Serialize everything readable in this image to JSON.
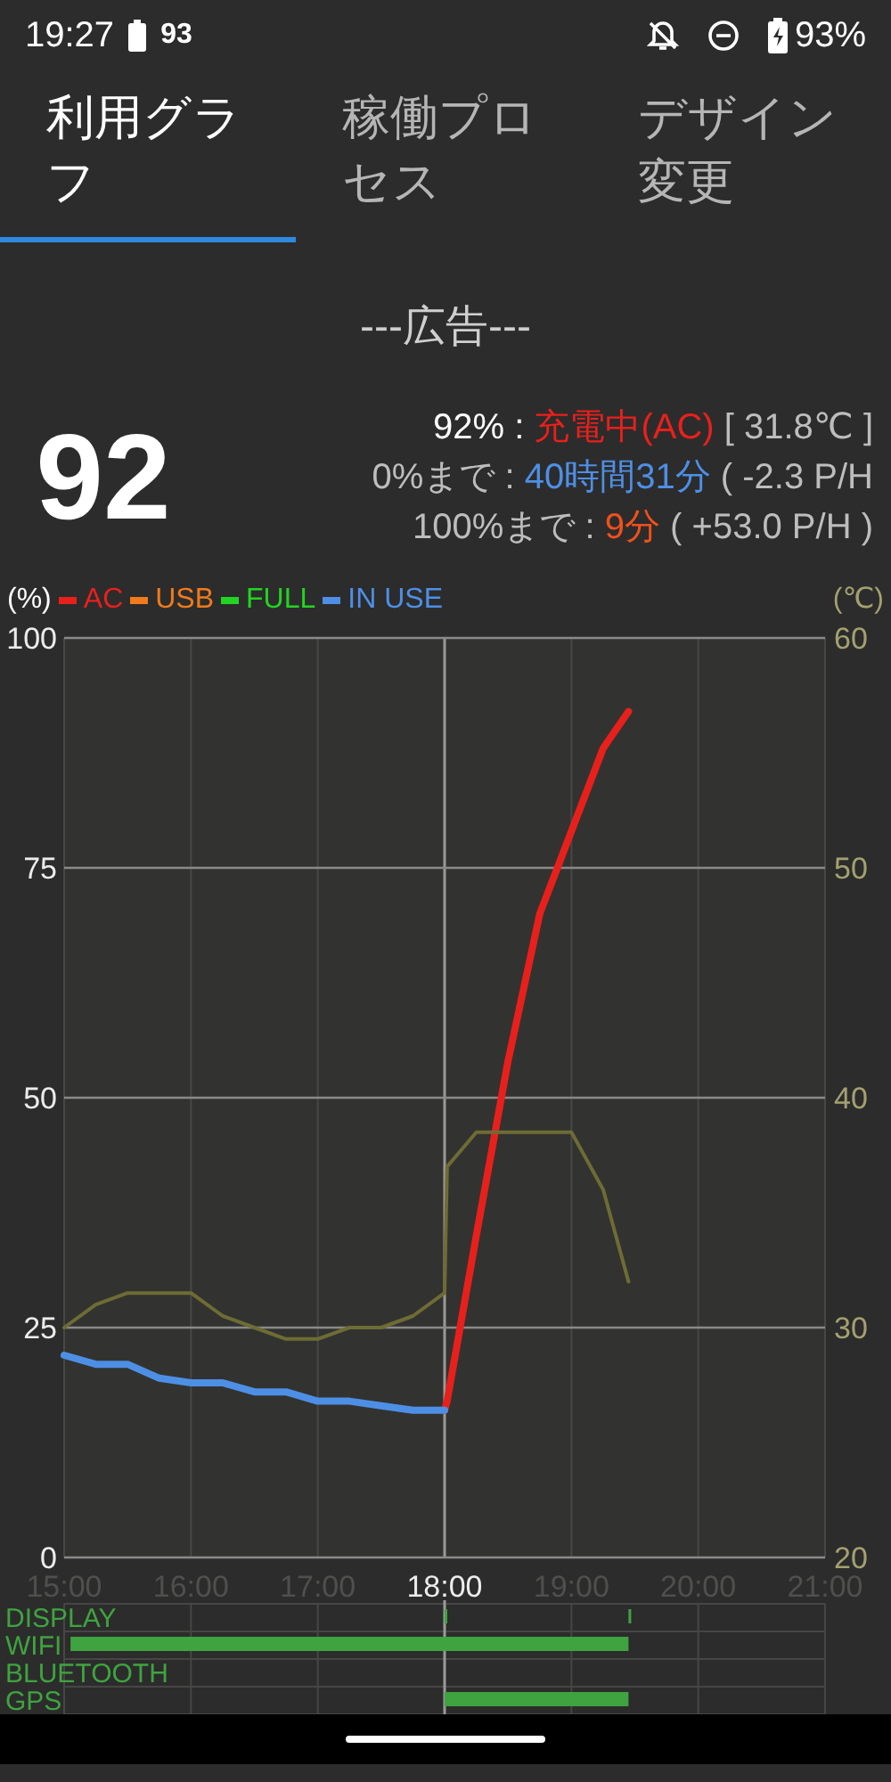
{
  "status_bar": {
    "time": "19:27",
    "battery_small": "93",
    "battery": "93%"
  },
  "tabs": [
    {
      "label": "利用グラフ",
      "selected": true
    },
    {
      "label": "稼働プロセス",
      "selected": false
    },
    {
      "label": "デザイン変更",
      "selected": false
    }
  ],
  "ad": "---広告---",
  "gauge": {
    "value": "92"
  },
  "info_lines": [
    {
      "parts": [
        {
          "text": "92% : ",
          "color": "#ffffff"
        },
        {
          "text": "充電中(AC)",
          "color": "#e8201c"
        },
        {
          "text": " [ 31.8℃ ]",
          "color": "#bdbdbd"
        }
      ]
    },
    {
      "parts": [
        {
          "text": "0%まで : ",
          "color": "#bdbdbd"
        },
        {
          "text": "40時間31分",
          "color": "#4e8fe6"
        },
        {
          "text": " ( -2.3 P/H",
          "color": "#bdbdbd"
        }
      ]
    },
    {
      "parts": [
        {
          "text": "100%まで : ",
          "color": "#bdbdbd"
        },
        {
          "text": "9分",
          "color": "#f0501c"
        },
        {
          "text": " ( +53.0 P/H )",
          "color": "#bdbdbd"
        }
      ]
    }
  ],
  "chart_data": {
    "type": "line",
    "ylabel": "(%)",
    "y2label": "(℃)",
    "xlim": [
      15,
      21
    ],
    "ylim": [
      0,
      100
    ],
    "y2lim": [
      20,
      60
    ],
    "xticks": [
      {
        "value": 15,
        "label": "15:00"
      },
      {
        "value": 16,
        "label": "16:00"
      },
      {
        "value": 17,
        "label": "17:00"
      },
      {
        "value": 18,
        "label": "18:00"
      },
      {
        "value": 19,
        "label": "19:00"
      },
      {
        "value": 20,
        "label": "20:00"
      },
      {
        "value": 21,
        "label": "21:00"
      }
    ],
    "yticks": [
      0,
      25,
      50,
      75,
      100
    ],
    "y2ticks": [
      20,
      30,
      40,
      50,
      60
    ],
    "ref_lines": [
      {
        "axis": "x",
        "value": 18
      }
    ],
    "grid": true,
    "legend": "top",
    "x": [
      15,
      15.25,
      15.5,
      15.75,
      16,
      16.25,
      16.5,
      16.75,
      17,
      17.25,
      17.5,
      17.75,
      18,
      18.02,
      18.25,
      18.5,
      18.75,
      19,
      19.25,
      19.45
    ],
    "series": [
      {
        "name": "AC",
        "color": "#e8201c",
        "values": [
          null,
          null,
          null,
          null,
          null,
          null,
          null,
          null,
          null,
          null,
          null,
          null,
          16,
          17,
          35,
          54,
          70,
          79,
          88,
          92
        ]
      },
      {
        "name": "USB",
        "color": "#f07a1c",
        "values": [
          null,
          null,
          null,
          null,
          null,
          null,
          null,
          null,
          null,
          null,
          null,
          null,
          null,
          null,
          null,
          null,
          null,
          null,
          null,
          null
        ]
      },
      {
        "name": "FULL",
        "color": "#22d422",
        "values": [
          null,
          null,
          null,
          null,
          null,
          null,
          null,
          null,
          null,
          null,
          null,
          null,
          null,
          null,
          null,
          null,
          null,
          null,
          null,
          null
        ]
      },
      {
        "name": "IN USE",
        "color": "#4e8fe6",
        "values": [
          22,
          21,
          21,
          19.5,
          19,
          19,
          18,
          18,
          17,
          17,
          16.5,
          16,
          16,
          null,
          null,
          null,
          null,
          null,
          null,
          null
        ]
      },
      {
        "color": "#6e6c34",
        "axis": "y2",
        "values": [
          30,
          31,
          31.5,
          31.5,
          31.5,
          30.5,
          30,
          29.5,
          29.5,
          30,
          30,
          30.5,
          31.5,
          37,
          38.5,
          38.5,
          38.5,
          38.5,
          36,
          32
        ]
      }
    ]
  },
  "timeline": {
    "rows": [
      "DISPLAY",
      "WIFI",
      "BLUETOOTH",
      "GPS"
    ]
  }
}
